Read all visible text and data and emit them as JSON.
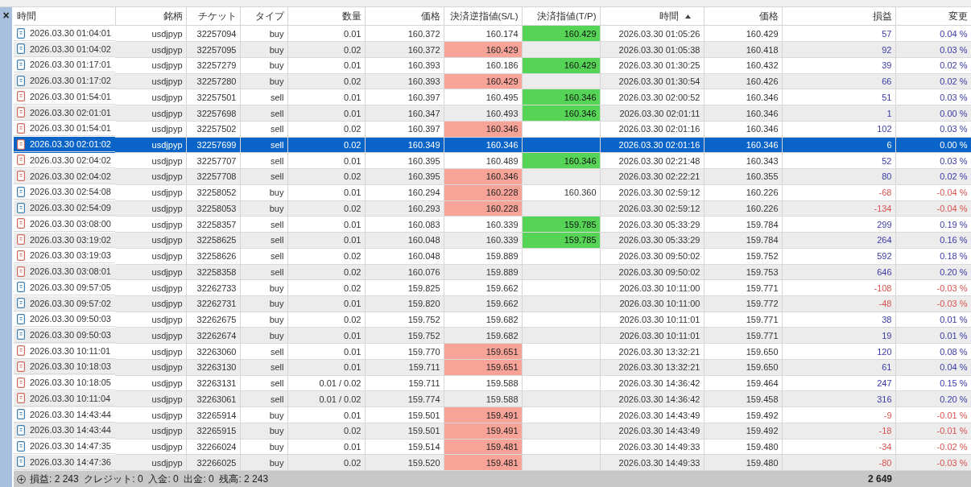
{
  "panel": {
    "close_glyph": "×"
  },
  "table": {
    "columns": [
      {
        "label": "時間",
        "sorted": false
      },
      {
        "label": "銘柄",
        "sorted": false
      },
      {
        "label": "チケット",
        "sorted": false
      },
      {
        "label": "タイプ",
        "sorted": false
      },
      {
        "label": "数量",
        "sorted": false
      },
      {
        "label": "価格",
        "sorted": false
      },
      {
        "label": "決済逆指値(S/L)",
        "sorted": false
      },
      {
        "label": "決済指値(T/P)",
        "sorted": false
      },
      {
        "label": "時間",
        "sorted": true
      },
      {
        "label": "価格",
        "sorted": false
      },
      {
        "label": "損益",
        "sorted": false
      },
      {
        "label": "変更",
        "sorted": false
      }
    ],
    "rows": [
      {
        "kind": "buy",
        "selected": false,
        "sl_hit": false,
        "tp_hit": true,
        "loss": false,
        "time": "2026.03.30 01:04:01",
        "symbol": "usdjpyp",
        "ticket": "32257094",
        "type": "buy",
        "volume": "0.01",
        "price": "160.372",
        "sl": "160.174",
        "tp": "160.429",
        "close_time": "2026.03.30 01:05:26",
        "close_price": "160.429",
        "profit": "57",
        "change": "0.04 %"
      },
      {
        "kind": "buy",
        "selected": false,
        "sl_hit": true,
        "tp_hit": false,
        "loss": false,
        "time": "2026.03.30 01:04:02",
        "symbol": "usdjpyp",
        "ticket": "32257095",
        "type": "buy",
        "volume": "0.02",
        "price": "160.372",
        "sl": "160.429",
        "close_time": "2026.03.30 01:05:38",
        "close_price": "160.418",
        "profit": "92",
        "change": "0.03 %"
      },
      {
        "kind": "buy",
        "selected": false,
        "sl_hit": false,
        "tp_hit": true,
        "loss": false,
        "time": "2026.03.30 01:17:01",
        "symbol": "usdjpyp",
        "ticket": "32257279",
        "type": "buy",
        "volume": "0.01",
        "price": "160.393",
        "sl": "160.186",
        "tp": "160.429",
        "close_time": "2026.03.30 01:30:25",
        "close_price": "160.432",
        "profit": "39",
        "change": "0.02 %"
      },
      {
        "kind": "buy",
        "selected": false,
        "sl_hit": true,
        "tp_hit": false,
        "loss": false,
        "time": "2026.03.30 01:17:02",
        "symbol": "usdjpyp",
        "ticket": "32257280",
        "type": "buy",
        "volume": "0.02",
        "price": "160.393",
        "sl": "160.429",
        "close_time": "2026.03.30 01:30:54",
        "close_price": "160.426",
        "profit": "66",
        "change": "0.02 %"
      },
      {
        "kind": "sell",
        "selected": false,
        "sl_hit": false,
        "tp_hit": true,
        "loss": false,
        "time": "2026.03.30 01:54:01",
        "symbol": "usdjpyp",
        "ticket": "32257501",
        "type": "sell",
        "volume": "0.01",
        "price": "160.397",
        "sl": "160.495",
        "tp": "160.346",
        "close_time": "2026.03.30 02:00:52",
        "close_price": "160.346",
        "profit": "51",
        "change": "0.03 %"
      },
      {
        "kind": "sell",
        "selected": false,
        "sl_hit": false,
        "tp_hit": true,
        "loss": false,
        "time": "2026.03.30 02:01:01",
        "symbol": "usdjpyp",
        "ticket": "32257698",
        "type": "sell",
        "volume": "0.01",
        "price": "160.347",
        "sl": "160.493",
        "tp": "160.346",
        "close_time": "2026.03.30 02:01:11",
        "close_price": "160.346",
        "profit": "1",
        "change": "0.00 %"
      },
      {
        "kind": "sell",
        "selected": false,
        "sl_hit": true,
        "tp_hit": false,
        "loss": false,
        "time": "2026.03.30 01:54:01",
        "symbol": "usdjpyp",
        "ticket": "32257502",
        "type": "sell",
        "volume": "0.02",
        "price": "160.397",
        "sl": "160.346",
        "close_time": "2026.03.30 02:01:16",
        "close_price": "160.346",
        "profit": "102",
        "change": "0.03 %"
      },
      {
        "kind": "sell",
        "selected": true,
        "sl_hit": false,
        "tp_hit": false,
        "loss": false,
        "time": "2026.03.30 02:01:02",
        "symbol": "usdjpyp",
        "ticket": "32257699",
        "type": "sell",
        "volume": "0.02",
        "price": "160.349",
        "sl": "160.346",
        "close_time": "2026.03.30 02:01:16",
        "close_price": "160.346",
        "profit": "6",
        "change": "0.00 %"
      },
      {
        "kind": "sell",
        "selected": false,
        "sl_hit": false,
        "tp_hit": true,
        "loss": false,
        "time": "2026.03.30 02:04:02",
        "symbol": "usdjpyp",
        "ticket": "32257707",
        "type": "sell",
        "volume": "0.01",
        "price": "160.395",
        "sl": "160.489",
        "tp": "160.346",
        "close_time": "2026.03.30 02:21:48",
        "close_price": "160.343",
        "profit": "52",
        "change": "0.03 %"
      },
      {
        "kind": "sell",
        "selected": false,
        "sl_hit": true,
        "tp_hit": false,
        "loss": false,
        "time": "2026.03.30 02:04:02",
        "symbol": "usdjpyp",
        "ticket": "32257708",
        "type": "sell",
        "volume": "0.02",
        "price": "160.395",
        "sl": "160.346",
        "close_time": "2026.03.30 02:22:21",
        "close_price": "160.355",
        "profit": "80",
        "change": "0.02 %"
      },
      {
        "kind": "buy",
        "selected": false,
        "sl_hit": true,
        "tp_hit": false,
        "loss": true,
        "time": "2026.03.30 02:54:08",
        "symbol": "usdjpyp",
        "ticket": "32258052",
        "type": "buy",
        "volume": "0.01",
        "price": "160.294",
        "sl": "160.228",
        "tp": "160.360",
        "close_time": "2026.03.30 02:59:12",
        "close_price": "160.226",
        "profit": "-68",
        "change": "-0.04 %"
      },
      {
        "kind": "buy",
        "selected": false,
        "sl_hit": true,
        "tp_hit": false,
        "loss": true,
        "time": "2026.03.30 02:54:09",
        "symbol": "usdjpyp",
        "ticket": "32258053",
        "type": "buy",
        "volume": "0.02",
        "price": "160.293",
        "sl": "160.228",
        "close_time": "2026.03.30 02:59:12",
        "close_price": "160.226",
        "profit": "-134",
        "change": "-0.04 %"
      },
      {
        "kind": "sell",
        "selected": false,
        "sl_hit": false,
        "tp_hit": true,
        "loss": false,
        "time": "2026.03.30 03:08:00",
        "symbol": "usdjpyp",
        "ticket": "32258357",
        "type": "sell",
        "volume": "0.01",
        "price": "160.083",
        "sl": "160.339",
        "tp": "159.785",
        "close_time": "2026.03.30 05:33:29",
        "close_price": "159.784",
        "profit": "299",
        "change": "0.19 %"
      },
      {
        "kind": "sell",
        "selected": false,
        "sl_hit": false,
        "tp_hit": true,
        "loss": false,
        "time": "2026.03.30 03:19:02",
        "symbol": "usdjpyp",
        "ticket": "32258625",
        "type": "sell",
        "volume": "0.01",
        "price": "160.048",
        "sl": "160.339",
        "tp": "159.785",
        "close_time": "2026.03.30 05:33:29",
        "close_price": "159.784",
        "profit": "264",
        "change": "0.16 %"
      },
      {
        "kind": "sell",
        "selected": false,
        "sl_hit": false,
        "tp_hit": false,
        "loss": false,
        "time": "2026.03.30 03:19:03",
        "symbol": "usdjpyp",
        "ticket": "32258626",
        "type": "sell",
        "volume": "0.02",
        "price": "160.048",
        "sl": "159.889",
        "close_time": "2026.03.30 09:50:02",
        "close_price": "159.752",
        "profit": "592",
        "change": "0.18 %"
      },
      {
        "kind": "sell",
        "selected": false,
        "sl_hit": false,
        "tp_hit": false,
        "loss": false,
        "time": "2026.03.30 03:08:01",
        "symbol": "usdjpyp",
        "ticket": "32258358",
        "type": "sell",
        "volume": "0.02",
        "price": "160.076",
        "sl": "159.889",
        "close_time": "2026.03.30 09:50:02",
        "close_price": "159.753",
        "profit": "646",
        "change": "0.20 %"
      },
      {
        "kind": "buy",
        "selected": false,
        "sl_hit": false,
        "tp_hit": false,
        "loss": true,
        "time": "2026.03.30 09:57:05",
        "symbol": "usdjpyp",
        "ticket": "32262733",
        "type": "buy",
        "volume": "0.02",
        "price": "159.825",
        "sl": "159.662",
        "close_time": "2026.03.30 10:11:00",
        "close_price": "159.771",
        "profit": "-108",
        "change": "-0.03 %"
      },
      {
        "kind": "buy",
        "selected": false,
        "sl_hit": false,
        "tp_hit": false,
        "loss": true,
        "time": "2026.03.30 09:57:02",
        "symbol": "usdjpyp",
        "ticket": "32262731",
        "type": "buy",
        "volume": "0.01",
        "price": "159.820",
        "sl": "159.662",
        "close_time": "2026.03.30 10:11:00",
        "close_price": "159.772",
        "profit": "-48",
        "change": "-0.03 %"
      },
      {
        "kind": "buy",
        "selected": false,
        "sl_hit": false,
        "tp_hit": false,
        "loss": false,
        "time": "2026.03.30 09:50:03",
        "symbol": "usdjpyp",
        "ticket": "32262675",
        "type": "buy",
        "volume": "0.02",
        "price": "159.752",
        "sl": "159.682",
        "close_time": "2026.03.30 10:11:01",
        "close_price": "159.771",
        "profit": "38",
        "change": "0.01 %"
      },
      {
        "kind": "buy",
        "selected": false,
        "sl_hit": false,
        "tp_hit": false,
        "loss": false,
        "time": "2026.03.30 09:50:03",
        "symbol": "usdjpyp",
        "ticket": "32262674",
        "type": "buy",
        "volume": "0.01",
        "price": "159.752",
        "sl": "159.682",
        "close_time": "2026.03.30 10:11:01",
        "close_price": "159.771",
        "profit": "19",
        "change": "0.01 %"
      },
      {
        "kind": "sell",
        "selected": false,
        "sl_hit": true,
        "tp_hit": false,
        "loss": false,
        "time": "2026.03.30 10:11:01",
        "symbol": "usdjpyp",
        "ticket": "32263060",
        "type": "sell",
        "volume": "0.01",
        "price": "159.770",
        "sl": "159.651",
        "close_time": "2026.03.30 13:32:21",
        "close_price": "159.650",
        "profit": "120",
        "change": "0.08 %"
      },
      {
        "kind": "sell",
        "selected": false,
        "sl_hit": true,
        "tp_hit": false,
        "loss": false,
        "time": "2026.03.30 10:18:03",
        "symbol": "usdjpyp",
        "ticket": "32263130",
        "type": "sell",
        "volume": "0.01",
        "price": "159.711",
        "sl": "159.651",
        "close_time": "2026.03.30 13:32:21",
        "close_price": "159.650",
        "profit": "61",
        "change": "0.04 %"
      },
      {
        "kind": "sell",
        "selected": false,
        "sl_hit": false,
        "tp_hit": false,
        "loss": false,
        "time": "2026.03.30 10:18:05",
        "symbol": "usdjpyp",
        "ticket": "32263131",
        "type": "sell",
        "volume": "0.01 / 0.02",
        "price": "159.711",
        "sl": "159.588",
        "close_time": "2026.03.30 14:36:42",
        "close_price": "159.464",
        "profit": "247",
        "change": "0.15 %"
      },
      {
        "kind": "sell",
        "selected": false,
        "sl_hit": false,
        "tp_hit": false,
        "loss": false,
        "time": "2026.03.30 10:11:04",
        "symbol": "usdjpyp",
        "ticket": "32263061",
        "type": "sell",
        "volume": "0.01 / 0.02",
        "price": "159.774",
        "sl": "159.588",
        "close_time": "2026.03.30 14:36:42",
        "close_price": "159.458",
        "profit": "316",
        "change": "0.20 %"
      },
      {
        "kind": "buy",
        "selected": false,
        "sl_hit": true,
        "tp_hit": false,
        "loss": true,
        "time": "2026.03.30 14:43:44",
        "symbol": "usdjpyp",
        "ticket": "32265914",
        "type": "buy",
        "volume": "0.01",
        "price": "159.501",
        "sl": "159.491",
        "close_time": "2026.03.30 14:43:49",
        "close_price": "159.492",
        "profit": "-9",
        "change": "-0.01 %"
      },
      {
        "kind": "buy",
        "selected": false,
        "sl_hit": true,
        "tp_hit": false,
        "loss": true,
        "time": "2026.03.30 14:43:44",
        "symbol": "usdjpyp",
        "ticket": "32265915",
        "type": "buy",
        "volume": "0.02",
        "price": "159.501",
        "sl": "159.491",
        "close_time": "2026.03.30 14:43:49",
        "close_price": "159.492",
        "profit": "-18",
        "change": "-0.01 %"
      },
      {
        "kind": "buy",
        "selected": false,
        "sl_hit": true,
        "tp_hit": false,
        "loss": true,
        "time": "2026.03.30 14:47:35",
        "symbol": "usdjpyp",
        "ticket": "32266024",
        "type": "buy",
        "volume": "0.01",
        "price": "159.514",
        "sl": "159.481",
        "close_time": "2026.03.30 14:49:33",
        "close_price": "159.480",
        "profit": "-34",
        "change": "-0.02 %"
      },
      {
        "kind": "buy",
        "selected": false,
        "sl_hit": true,
        "tp_hit": false,
        "loss": true,
        "time": "2026.03.30 14:47:36",
        "symbol": "usdjpyp",
        "ticket": "32266025",
        "type": "buy",
        "volume": "0.02",
        "price": "159.520",
        "sl": "159.481",
        "close_time": "2026.03.30 14:49:33",
        "close_price": "159.480",
        "profit": "-80",
        "change": "-0.03 %"
      }
    ],
    "summary": {
      "text": "損益: 2 243  クレジット: 0  入金: 0  出金: 0  残高: 2 243",
      "total_profit": "2 649"
    }
  }
}
